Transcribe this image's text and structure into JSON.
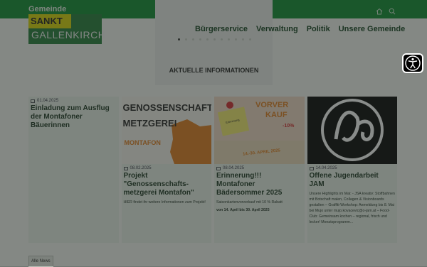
{
  "header": {
    "org_label": "Gemeinde",
    "logo_line1": "SANKT",
    "logo_line2": "GALLENKIRCH"
  },
  "nav": {
    "items": [
      "Bürgerservice",
      "Verwaltung",
      "Politik",
      "Unsere Gemeinde"
    ]
  },
  "slider": {
    "dot_count": 11,
    "active_index": 0,
    "title": "AKTUELLE INFORMATIONEN"
  },
  "cards": [
    {
      "date": "01.04.2025",
      "title": "Einladung zum Ausflug der Montafoner Bäuerinnen",
      "text": "",
      "image_text": ""
    },
    {
      "date": "08.02.2025",
      "title": "Projekt \"Genossenschafts- metzgerei Montafon\"",
      "text": "HIER findet ihr weitere Informationen zum Projekt!",
      "image_text_1": "GENOSSENSCHAFTS",
      "image_text_2": "METZGEREI",
      "image_text_3": "MONTAFON"
    },
    {
      "date": "08.04.2025",
      "title": "Erinnerung!!! Montafoner Bädersommer 2025",
      "text": "Saisonkartenvorverkauf mit 10 % Rabatt",
      "text_b": "von 14. April bis 30. April 2025",
      "image_text_1": "VORVER",
      "image_text_2": "KAUF",
      "image_text_3": "-10%",
      "image_text_4": "14.-30. APRIL 2025",
      "image_text_5": "Erinnerung"
    },
    {
      "date": "14.04.2025",
      "title": "Offene Jugendarbeit JAM",
      "text": "Unsere Highlights im Mai: - JSA kreativ: Stoffbahnen mit Botschaft malen, Collagen & Visionboards gestalten – Graffiti-Workshop: Anmeldung bis 8. Mai bei Mujo unter mujo.kovacevic@o-jam.at – Food-Club: Gemeinsam kochen – regional, frisch und lecker! Monatsprogramm..."
    }
  ],
  "all_news_label": "Alle News",
  "colors": {
    "brand_green": "#0a8a2e",
    "logo_yellow": "#d9d500",
    "card_bg": "#e7f0e6"
  }
}
